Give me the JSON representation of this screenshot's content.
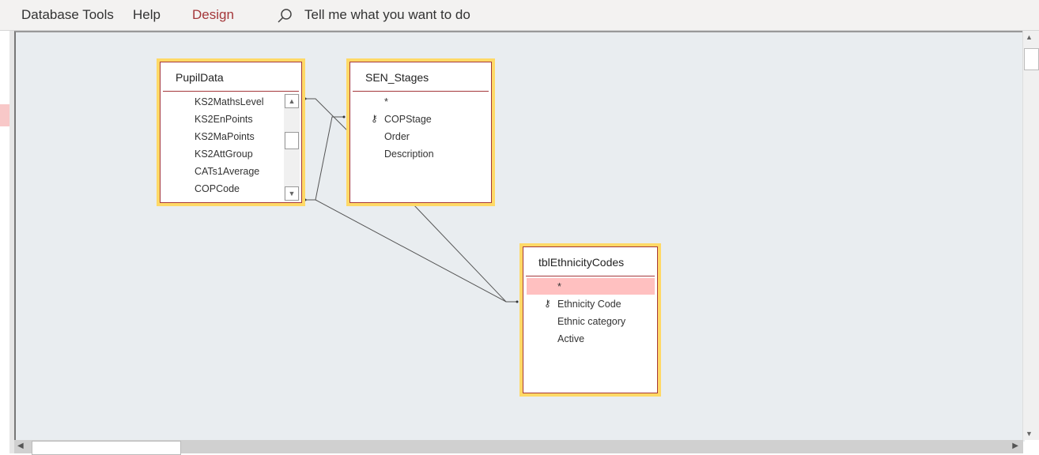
{
  "ribbon": {
    "tabs": [
      "Database Tools",
      "Help",
      "Design"
    ],
    "search_placeholder": "Tell me what you want to do"
  },
  "tables": [
    {
      "name": "PupilData",
      "fields": [
        "KS2MathsLevel",
        "KS2EnPoints",
        "KS2MaPoints",
        "KS2AttGroup",
        "CATs1Average",
        "COPCode"
      ]
    },
    {
      "name": "SEN_Stages",
      "fields": [
        "*",
        "COPStage",
        "Order",
        "Description"
      ],
      "key": "COPStage"
    },
    {
      "name": "tblEthnicityCodes",
      "fields": [
        "*",
        "Ethnicity Code",
        "Ethnic category",
        "Active"
      ],
      "key": "Ethnicity Code"
    }
  ],
  "colors": {
    "accent": "#a4373a",
    "selection_border": "#ffd966",
    "highlight": "#ffc0c0"
  }
}
